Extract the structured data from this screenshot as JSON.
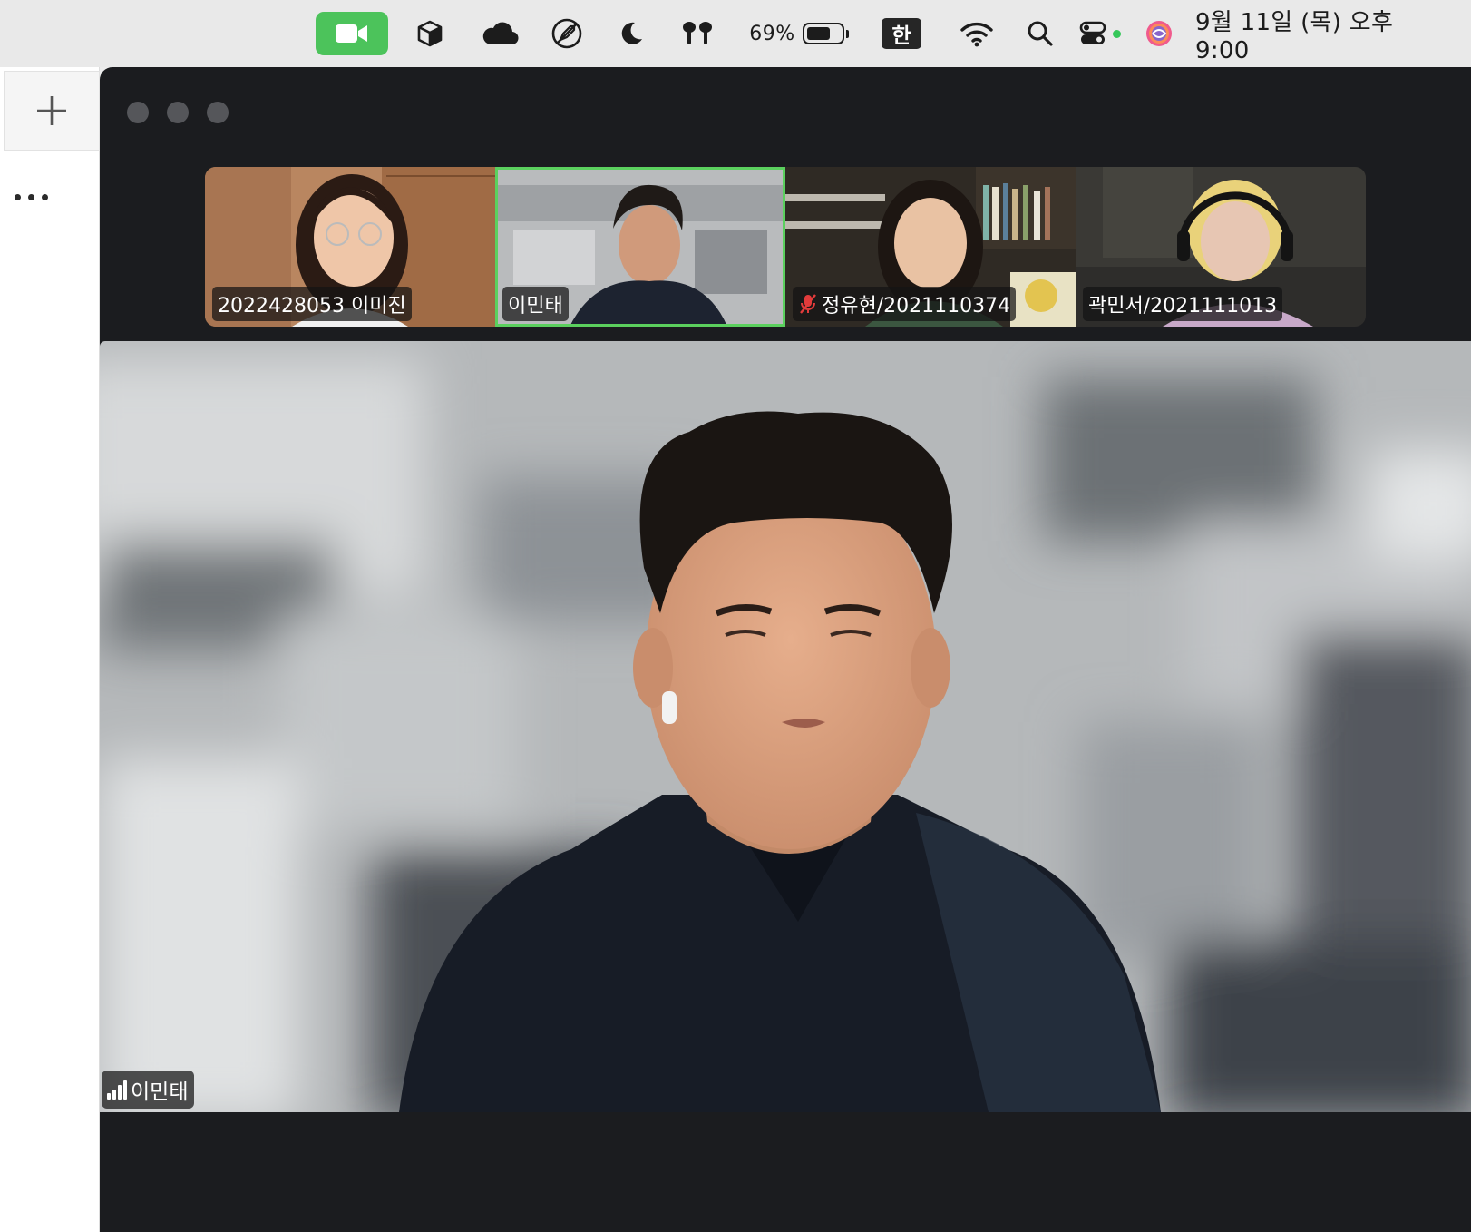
{
  "menubar": {
    "icons": [
      "zoom-camera-icon",
      "box-icon",
      "cloud-icon",
      "rocket-icon",
      "moon-icon",
      "airpods-icon",
      "wifi-icon",
      "search-icon",
      "control-center-icon",
      "siri-icon"
    ],
    "battery_percent": "69%",
    "battery_level": 0.69,
    "input_method": "한",
    "clock": "9월 11일 (목) 오후 9:00",
    "accent_color": "#4cc35b"
  },
  "side_panel": {
    "icons": [
      "plus-icon",
      "more-icon"
    ]
  },
  "meeting": {
    "participants": [
      {
        "name": "2022428053 이미진",
        "muted": false,
        "active": false
      },
      {
        "name": "이민태",
        "muted": false,
        "active": true
      },
      {
        "name": "정유현/2021110374",
        "muted": true,
        "active": false
      },
      {
        "name": "곽민서/2021111013",
        "muted": false,
        "active": false
      }
    ],
    "speaker": {
      "name": "이민태"
    },
    "active_border_color": "#5bd05e",
    "muted_icon_color": "#e23b3b"
  }
}
